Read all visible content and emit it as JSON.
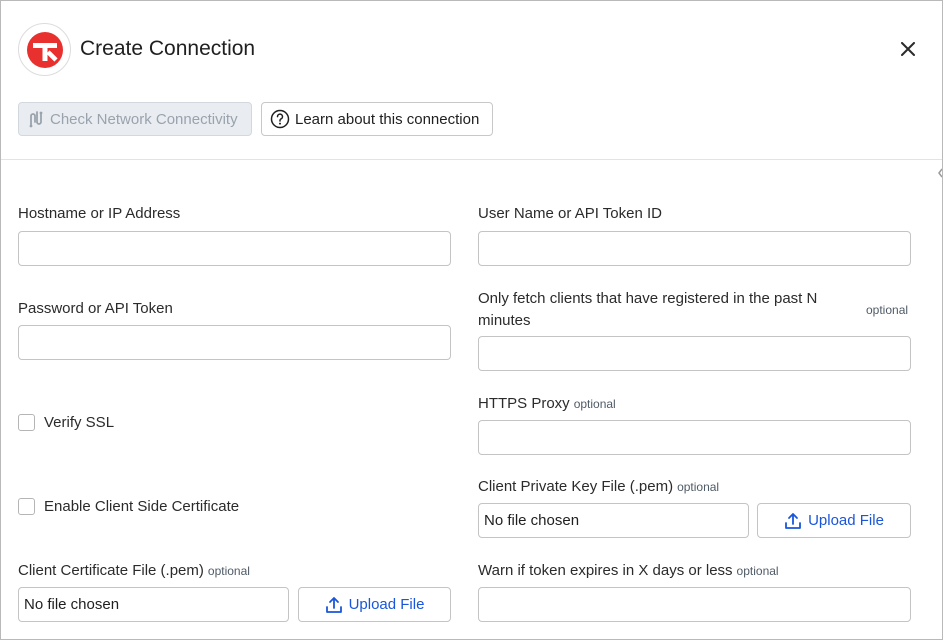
{
  "header": {
    "title": "Create Connection"
  },
  "toolbar": {
    "check_label": "Check Network Connectivity",
    "learn_label": "Learn about this connection"
  },
  "form": {
    "hostname_label": "Hostname or IP Address",
    "hostname_value": "",
    "username_label": "User Name or API Token ID",
    "username_value": "",
    "password_label": "Password or API Token",
    "password_value": "",
    "fetch_label_line1": "Only fetch clients that have registered in the past N",
    "fetch_label_line2": "minutes",
    "fetch_optional": "optional",
    "fetch_value": "",
    "verify_ssl_label": "Verify SSL",
    "https_proxy_label": "HTTPS Proxy",
    "https_proxy_optional": "optional",
    "https_proxy_value": "",
    "client_side_cert_label": "Enable Client Side Certificate",
    "private_key_label": "Client Private Key File (.pem)",
    "private_key_optional": "optional",
    "private_key_file": "No file chosen",
    "client_cert_label": "Client Certificate File (.pem)",
    "client_cert_optional": "optional",
    "client_cert_file": "No file chosen",
    "upload_label": "Upload File",
    "warn_label": "Warn if token expires in X days or less",
    "warn_optional": "optional",
    "warn_value": ""
  },
  "colors": {
    "brand_red": "#e8302f",
    "link_blue": "#1a56db",
    "disabled_bg": "#e9edf2"
  }
}
